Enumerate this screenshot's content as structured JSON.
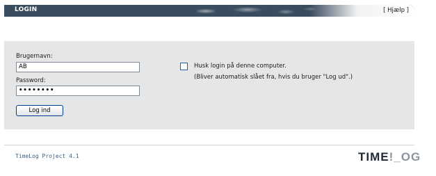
{
  "header": {
    "title": "LOGIN",
    "help_label": "[ Hjælp ]"
  },
  "form": {
    "username_label": "Brugernavn:",
    "username_value": "AB",
    "password_label": "Password:",
    "password_value": "••••••••",
    "submit_label": "Log ind",
    "remember_label": "Husk login på denne computer.",
    "remember_note": "(Bliver automatisk slået fra, hvis du bruger \"Log ud\".)",
    "remember_checked": false
  },
  "footer": {
    "version": "TimeLog Project 4.1",
    "logo_part1": "TIME",
    "logo_part2": "!_OG"
  },
  "colors": {
    "header_bg": "#3a4d5f",
    "band_bg": "#e4e6e8",
    "button_border": "#003c8f",
    "version_text": "#3a5e80"
  }
}
